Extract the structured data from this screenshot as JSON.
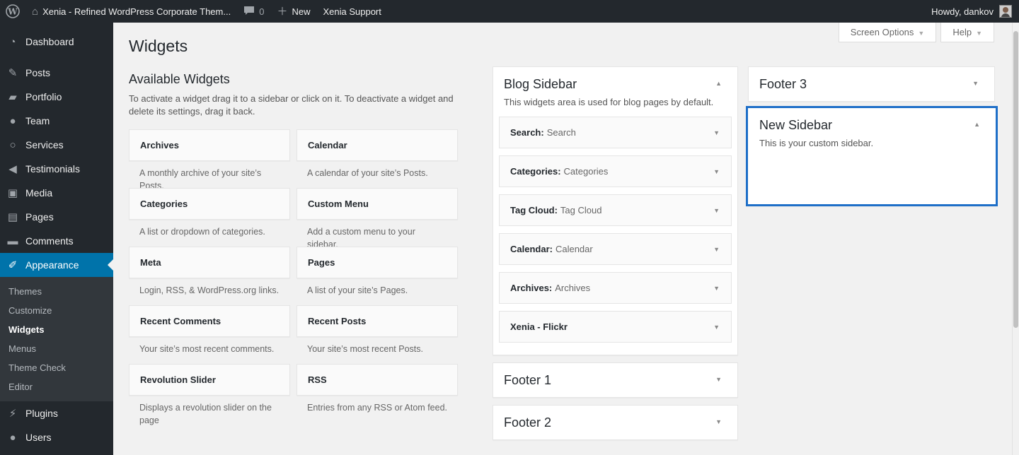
{
  "adminbar": {
    "site_title": "Xenia - Refined WordPress Corporate Them...",
    "comments_count": "0",
    "new_label": "New",
    "support_label": "Xenia Support",
    "howdy": "Howdy, dankov"
  },
  "menu": {
    "dashboard": "Dashboard",
    "posts": "Posts",
    "portfolio": "Portfolio",
    "team": "Team",
    "services": "Services",
    "testimonials": "Testimonials",
    "media": "Media",
    "pages": "Pages",
    "comments": "Comments",
    "appearance": "Appearance",
    "sub": [
      "Themes",
      "Customize",
      "Widgets",
      "Menus",
      "Theme Check",
      "Editor"
    ],
    "plugins": "Plugins",
    "users": "Users"
  },
  "screen_meta": {
    "screen_options": "Screen Options",
    "help": "Help"
  },
  "page_title": "Widgets",
  "available": {
    "heading": "Available Widgets",
    "description": "To activate a widget drag it to a sidebar or click on it. To deactivate a widget and delete its settings, drag it back.",
    "widgets": [
      {
        "title": "Archives",
        "desc": "A monthly archive of your site’s Posts."
      },
      {
        "title": "Calendar",
        "desc": "A calendar of your site’s Posts."
      },
      {
        "title": "Categories",
        "desc": "A list or dropdown of categories."
      },
      {
        "title": "Custom Menu",
        "desc": "Add a custom menu to your sidebar."
      },
      {
        "title": "Meta",
        "desc": "Login, RSS, & WordPress.org links."
      },
      {
        "title": "Pages",
        "desc": "A list of your site’s Pages."
      },
      {
        "title": "Recent Comments",
        "desc": "Your site’s most recent comments."
      },
      {
        "title": "Recent Posts",
        "desc": "Your site’s most recent Posts."
      },
      {
        "title": "Revolution Slider",
        "desc": "Displays a revolution slider on the page"
      },
      {
        "title": "RSS",
        "desc": "Entries from any RSS or Atom feed."
      }
    ]
  },
  "blog_sidebar": {
    "title": "Blog Sidebar",
    "description": "This widgets area is used for blog pages by default.",
    "widgets": [
      {
        "name": "Search:",
        "instance": "Search"
      },
      {
        "name": "Categories:",
        "instance": "Categories"
      },
      {
        "name": "Tag Cloud:",
        "instance": "Tag Cloud"
      },
      {
        "name": "Calendar:",
        "instance": "Calendar"
      },
      {
        "name": "Archives:",
        "instance": "Archives"
      },
      {
        "name": "Xenia - Flickr",
        "instance": ""
      }
    ]
  },
  "footer1": {
    "title": "Footer 1"
  },
  "footer2": {
    "title": "Footer 2"
  },
  "footer3": {
    "title": "Footer 3"
  },
  "new_sidebar": {
    "title": "New Sidebar",
    "description": "This is your custom sidebar."
  },
  "colors": {
    "adminbar_bg": "#23282d",
    "current_menu": "#0073aa",
    "highlight_border": "#1e6fc8"
  },
  "icons": [
    "wordpress-logo-icon",
    "home-icon",
    "comment-icon",
    "plus-icon",
    "dashboard-icon",
    "pin-icon",
    "portfolio-icon",
    "team-icon",
    "services-icon",
    "testimonials-icon",
    "media-icon",
    "pages-icon",
    "comments-icon",
    "appearance-icon",
    "plugins-icon",
    "users-icon"
  ]
}
